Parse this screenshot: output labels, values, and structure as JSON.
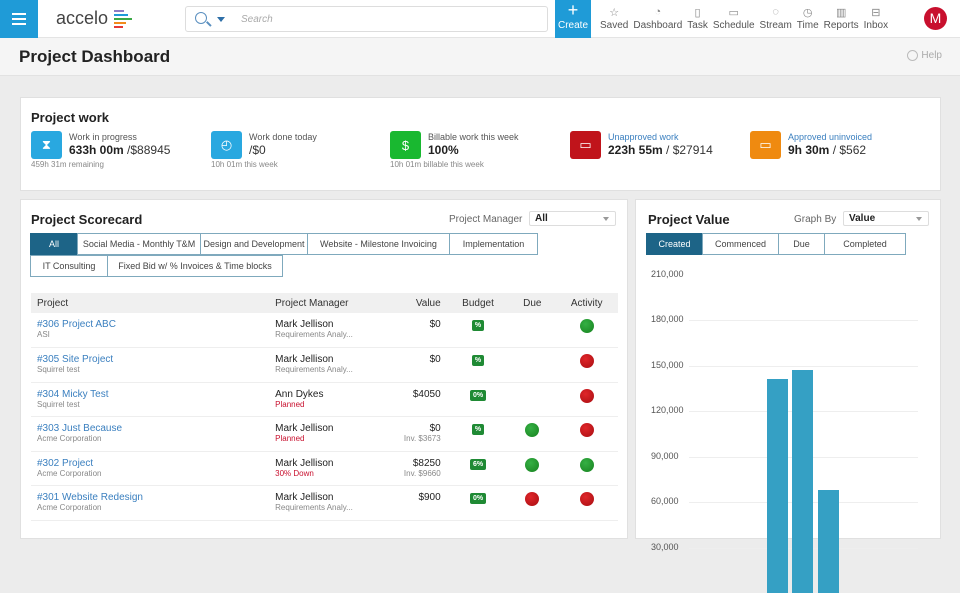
{
  "topbar": {
    "menu_icon": "hamburger-menu-icon",
    "logo": "accelo",
    "logo_bar_colors": [
      "#8e7cc3",
      "#1f9bd7",
      "#3aa845",
      "#f28a1c",
      "#e53935"
    ],
    "search_placeholder": "Search",
    "create_label": "Create",
    "nav": [
      {
        "label": "Saved",
        "icon": "star-icon"
      },
      {
        "label": "Dashboard",
        "icon": "gauge-icon"
      },
      {
        "label": "Task",
        "icon": "clipboard-icon"
      },
      {
        "label": "Schedule",
        "icon": "calendar-icon"
      },
      {
        "label": "Stream",
        "icon": "chat-bubbles-icon"
      },
      {
        "label": "Time",
        "icon": "clock-icon"
      },
      {
        "label": "Reports",
        "icon": "bar-chart-icon"
      },
      {
        "label": "Inbox",
        "icon": "inbox-icon"
      }
    ],
    "avatar_initial": "M",
    "avatar_color": "#c8102e",
    "accent": "#1f9bd7"
  },
  "page": {
    "title": "Project Dashboard",
    "help_label": "Help"
  },
  "project_work": {
    "title": "Project work",
    "stats": [
      {
        "label": "Work in progress",
        "value_bold": "633h 00m",
        "value_rest": " /$88945",
        "sub": "459h 31m remaining",
        "icon": "hourglass-icon",
        "color": "#29a8e0"
      },
      {
        "label": "Work done today",
        "value_bold": "",
        "value_rest": "/$0",
        "sub": "10h 01m this week",
        "icon": "stopwatch-icon",
        "color": "#29a8e0"
      },
      {
        "label": "Billable work this week",
        "value_bold": "100%",
        "value_rest": "",
        "sub": "10h 01m billable this week",
        "icon": "dollar-tag-icon",
        "color": "#19b830"
      },
      {
        "label": "Unapproved work",
        "value_bold": "223h 55m",
        "value_rest": " / $27914",
        "sub": "",
        "icon": "battery-low-icon",
        "color": "#c0141b"
      },
      {
        "label": "Approved uninvoiced",
        "value_bold": "9h 30m",
        "value_rest": " / $562",
        "sub": "",
        "icon": "battery-half-icon",
        "color": "#ef8a10"
      }
    ]
  },
  "scorecard": {
    "title": "Project Scorecard",
    "pm_label": "Project Manager",
    "pm_value": "All",
    "tabs_row1": [
      "All",
      "Social Media - Monthly T&M",
      "Design and Development",
      "Website - Milestone Invoicing",
      "Implementation"
    ],
    "tabs_row2": [
      "IT Consulting",
      "Fixed Bid w/ % Invoices & Time blocks"
    ],
    "active_tab": "All",
    "columns": [
      "Project",
      "Project Manager",
      "Value",
      "Budget",
      "Due",
      "Activity"
    ],
    "rows": [
      {
        "project": "#306 Project ABC",
        "client": "ASI",
        "manager": "Mark Jellison",
        "status": "Requirements Analy...",
        "status_red": false,
        "value": "$0",
        "inv": "",
        "budget": "%",
        "due": "",
        "activity": "green"
      },
      {
        "project": "#305 Site Project",
        "client": "Squirrel test",
        "manager": "Mark Jellison",
        "status": "Requirements Analy...",
        "status_red": false,
        "value": "$0",
        "inv": "",
        "budget": "%",
        "due": "",
        "activity": "red"
      },
      {
        "project": "#304 Micky Test",
        "client": "Squirrel test",
        "manager": "Ann Dykes",
        "status": "Planned",
        "status_red": true,
        "value": "$4050",
        "inv": "",
        "budget": "0%",
        "due": "",
        "activity": "red"
      },
      {
        "project": "#303 Just Because",
        "client": "Acme Corporation",
        "manager": "Mark Jellison",
        "status": "Planned",
        "status_red": true,
        "value": "$0",
        "inv": "Inv. $3673",
        "budget": "%",
        "due": "green",
        "activity": "red"
      },
      {
        "project": "#302 Project",
        "client": "Acme Corporation",
        "manager": "Mark Jellison",
        "status": "30% Down",
        "status_red": true,
        "value": "$8250",
        "inv": "Inv. $9660",
        "budget": "6%",
        "due": "green",
        "activity": "green"
      },
      {
        "project": "#301 Website Redesign",
        "client": "Acme Corporation",
        "manager": "Mark Jellison",
        "status": "Requirements Analy...",
        "status_red": false,
        "value": "$900",
        "inv": "",
        "budget": "0%",
        "due": "red",
        "activity": "red"
      }
    ]
  },
  "project_value": {
    "title": "Project Value",
    "graph_by_label": "Graph By",
    "graph_by_value": "Value",
    "tabs": [
      "Created",
      "Commenced",
      "Due",
      "Completed"
    ],
    "active_tab": "Created"
  },
  "chart_data": {
    "type": "bar",
    "title": "Project Value",
    "xlabel": "",
    "ylabel": "",
    "categories": [
      "",
      "",
      ""
    ],
    "values": [
      141000,
      147000,
      68000
    ],
    "yticks": [
      30000,
      60000,
      90000,
      120000,
      150000,
      180000,
      210000
    ],
    "ytick_labels": [
      "30,000",
      "60,000",
      "90,000",
      "120,000",
      "150,000",
      "180,000",
      "210,000"
    ],
    "ylim": [
      0,
      210000
    ],
    "grid": true,
    "bar_color": "#35a0c4"
  }
}
